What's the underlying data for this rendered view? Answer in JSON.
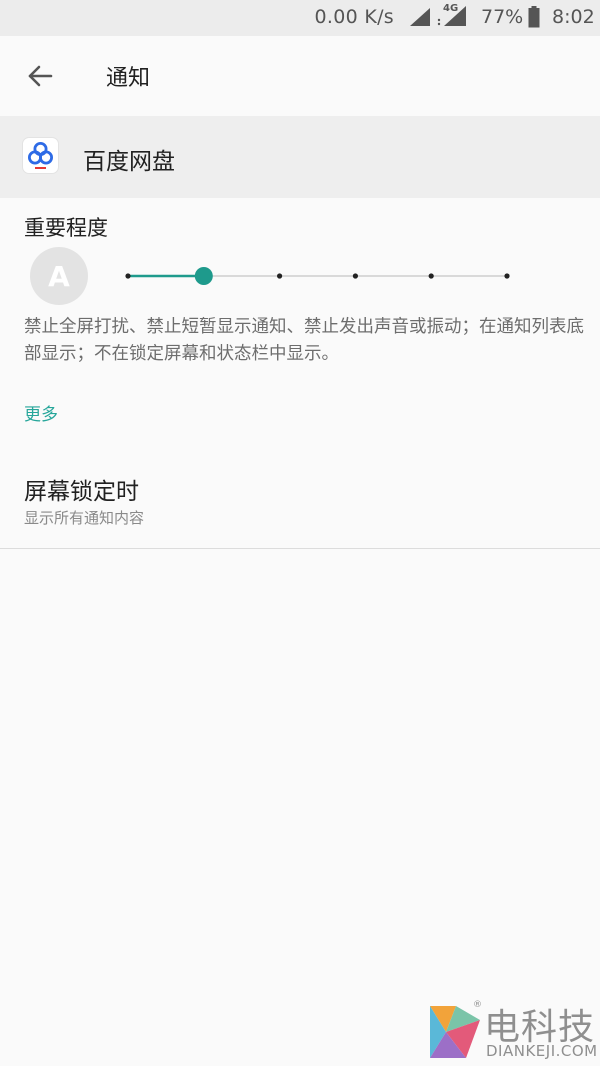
{
  "status_bar": {
    "net_speed": "0.00 K/s",
    "network_type": "4G",
    "battery_percent": "77%",
    "time": "8:02",
    "icons": [
      "wifi-signal-icon",
      "cell-signal-icon",
      "battery-icon"
    ]
  },
  "toolbar": {
    "back_icon": "arrow-left-icon",
    "title": "通知"
  },
  "app": {
    "icon": "baidu-netdisk-icon",
    "name": "百度网盘"
  },
  "importance": {
    "title": "重要程度",
    "avatar_letter": "A",
    "level": 2,
    "levels_total": 6,
    "description": "禁止全屏打扰、禁止短暂显示通知、禁止发出声音或振动；在通知列表底部显示；不在锁定屏幕和状态栏中显示。",
    "accent_color": "#1e9a8c"
  },
  "more_label": "更多",
  "lock_screen": {
    "title": "屏幕锁定时",
    "subtitle": "显示所有通知内容"
  },
  "watermark": {
    "text": "电科技",
    "sub": "DIANKEJI.COM",
    "reg": "®"
  }
}
